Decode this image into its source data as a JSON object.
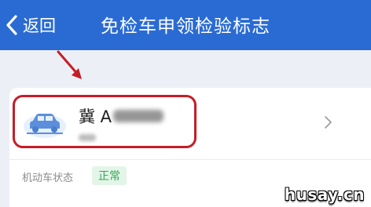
{
  "header": {
    "back_label": "返回",
    "title": "免检车申领检验标志"
  },
  "vehicle": {
    "plate_visible": "冀 A",
    "icon": "car-icon"
  },
  "status": {
    "label": "机动车状态",
    "value": "正常"
  },
  "watermark": "husay.cn",
  "colors": {
    "nav_background": "#2a6bd3",
    "page_background": "#ecf0f6",
    "highlight": "#c51d28",
    "status_green": "#34a853"
  }
}
